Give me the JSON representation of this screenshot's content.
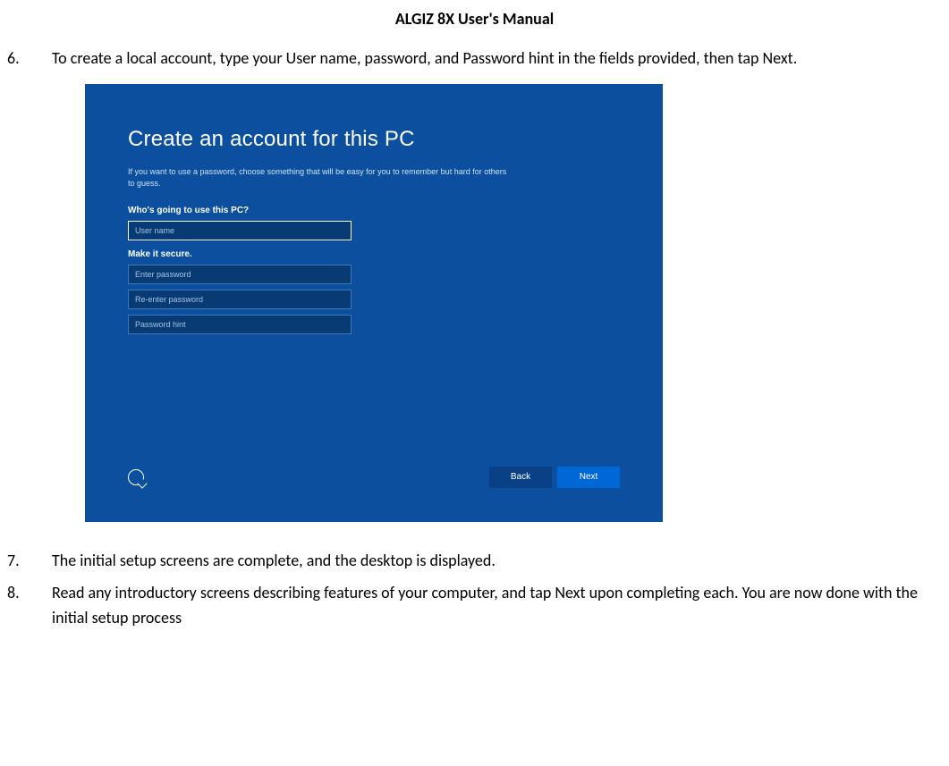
{
  "header": {
    "title": "ALGIZ 8X User's Manual"
  },
  "steps": {
    "s6": {
      "marker": "6.",
      "text": "To create a local account, type your User name, password, and Password hint in the fields provided, then tap Next."
    },
    "s7": {
      "marker": "7.",
      "text": "The initial setup screens are complete, and the desktop is displayed."
    },
    "s8": {
      "marker": "8.",
      "text": "Read any introductory screens describing features of your computer, and tap Next upon completing each. You are now done with the initial setup process"
    }
  },
  "screenshot": {
    "title": "Create an account for this PC",
    "description": "If you want to use a password, choose something that will be easy for you to remember but hard for others to guess.",
    "whoLabel": "Who's going to use this PC?",
    "fields": {
      "username_placeholder": "User name",
      "secureLabel": "Make it secure.",
      "password_placeholder": "Enter password",
      "password2_placeholder": "Re-enter password",
      "hint_placeholder": "Password hint"
    },
    "buttons": {
      "back": "Back",
      "next": "Next"
    }
  }
}
